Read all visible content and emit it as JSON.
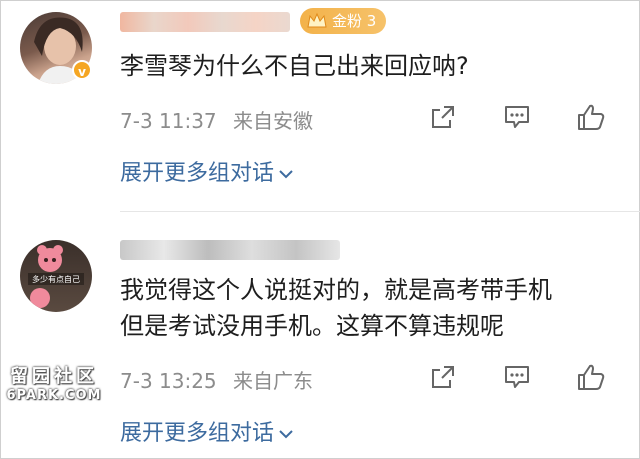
{
  "comments": [
    {
      "badge": "金粉 3",
      "text": "李雪琴为什么不自己出来回应呐?",
      "time": "7-3 11:37",
      "location": "来自安徽",
      "expand": "展开更多组对话",
      "verified_mark": "v"
    },
    {
      "avatar_caption": "多少有点自己",
      "text_lines": [
        "我觉得这个人说挺对的，就是高考带手机",
        "但是考试没用手机。这算不算违规呢"
      ],
      "time": "7-3 13:25",
      "location": "来自广东",
      "expand": "展开更多组对话"
    }
  ],
  "watermark": {
    "line1": "留园社区",
    "line2": "6PARK.COM"
  },
  "icons": [
    "share-icon",
    "comment-icon",
    "like-icon"
  ],
  "colors": {
    "badge": "#f3b24a",
    "link": "#3d6b9f",
    "meta": "#8c8c8c",
    "text": "#1e1e1e"
  }
}
